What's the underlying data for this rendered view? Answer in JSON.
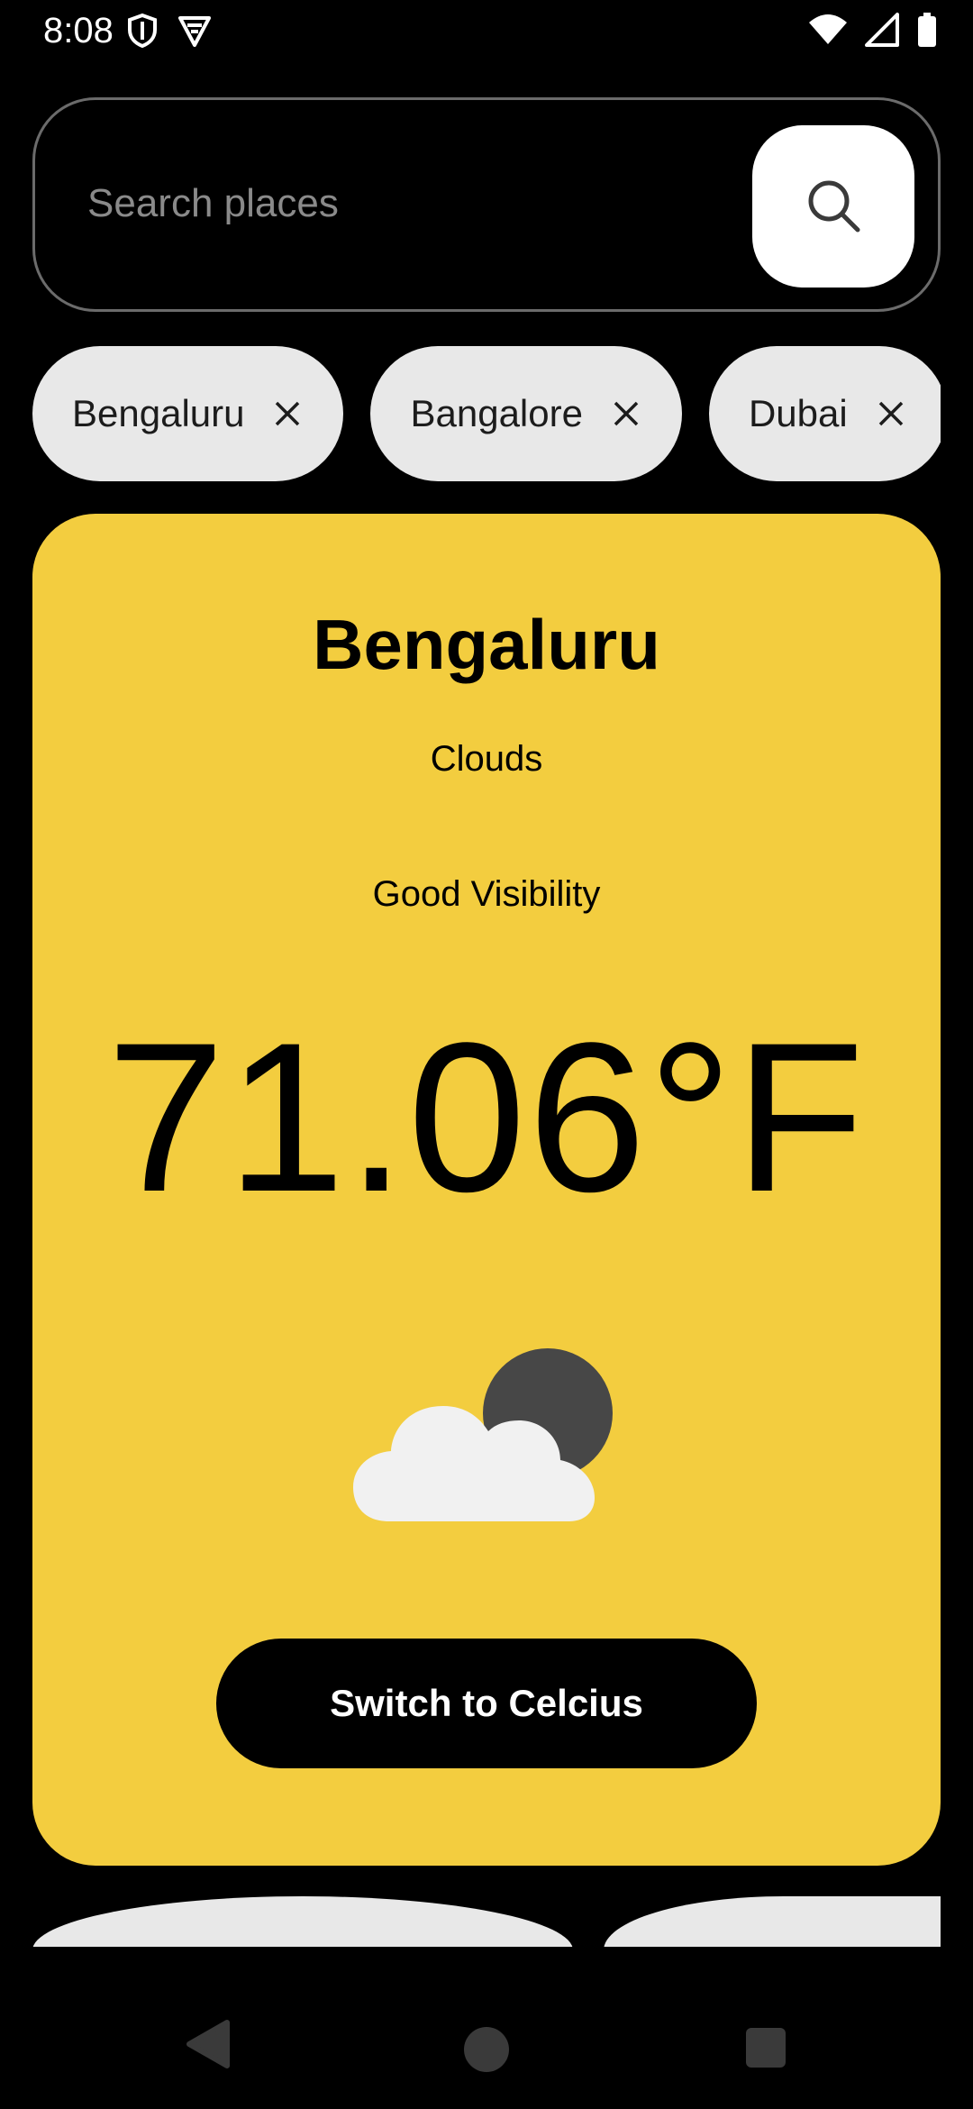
{
  "status_bar": {
    "time": "8:08",
    "left_icons": [
      "shield-icon",
      "vpn-icon"
    ],
    "right_icons": [
      "wifi-icon",
      "signal-icon",
      "battery-icon"
    ]
  },
  "search": {
    "placeholder": "Search places",
    "value": "",
    "button_icon": "search-icon"
  },
  "chips": [
    {
      "label": "Bengaluru",
      "close_icon": "close-icon"
    },
    {
      "label": "Bangalore",
      "close_icon": "close-icon"
    },
    {
      "label": "Dubai",
      "close_icon": "close-icon"
    }
  ],
  "weather": {
    "city": "Bengaluru",
    "condition": "Clouds",
    "visibility": "Good Visibility",
    "temperature": "71.06°F",
    "icon": "cloud-night-icon",
    "switch_label": "Switch to Celcius"
  },
  "colors": {
    "card_background": "#f3cd3f",
    "chip_background": "#e8e8e8",
    "button_background": "#000000"
  },
  "nav_bar": {
    "icons": [
      "back-icon",
      "home-icon",
      "recents-icon"
    ]
  }
}
